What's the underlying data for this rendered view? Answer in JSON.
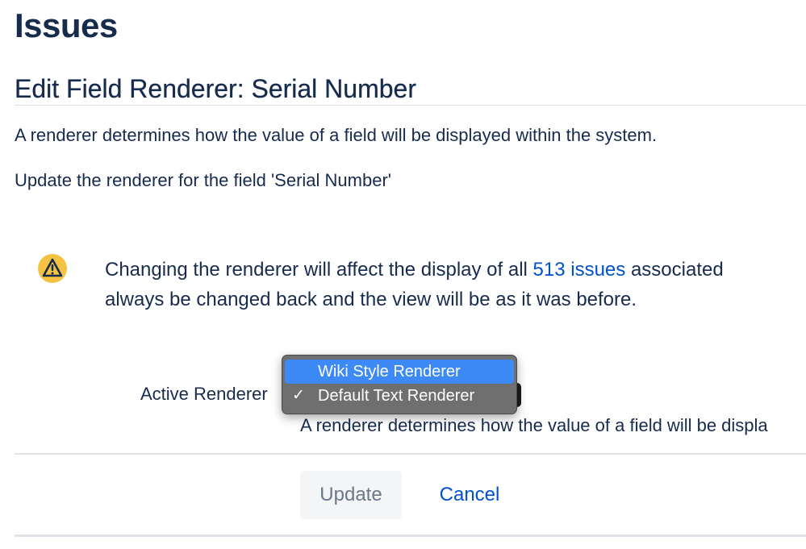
{
  "page": {
    "title": "Issues"
  },
  "section": {
    "title": "Edit Field Renderer: Serial Number",
    "description": "A renderer determines how the value of a field will be displayed within the system.",
    "instruction": "Update the renderer for the field 'Serial Number'"
  },
  "warning": {
    "icon": "warning-icon",
    "text_before": "Changing the renderer will affect the display of all ",
    "link_text": "513 issues",
    "text_after": " associated",
    "line2": "always be changed back and the view will be as it was before."
  },
  "form": {
    "active_renderer_label": "Active Renderer",
    "selected_option": "Default Text Renderer",
    "options": [
      {
        "label": "Wiki Style Renderer",
        "checked": false,
        "highlighted": true
      },
      {
        "label": "Default Text Renderer",
        "checked": true,
        "highlighted": false
      }
    ],
    "check_glyph": "✓",
    "help_text": "A renderer determines how the value of a field will be displa"
  },
  "buttons": {
    "update_label": "Update",
    "cancel_label": "Cancel"
  },
  "colors": {
    "text": "#172b4d",
    "link": "#0052cc",
    "warning_yellow": "#f5c344",
    "highlight": "#3d89f5"
  }
}
